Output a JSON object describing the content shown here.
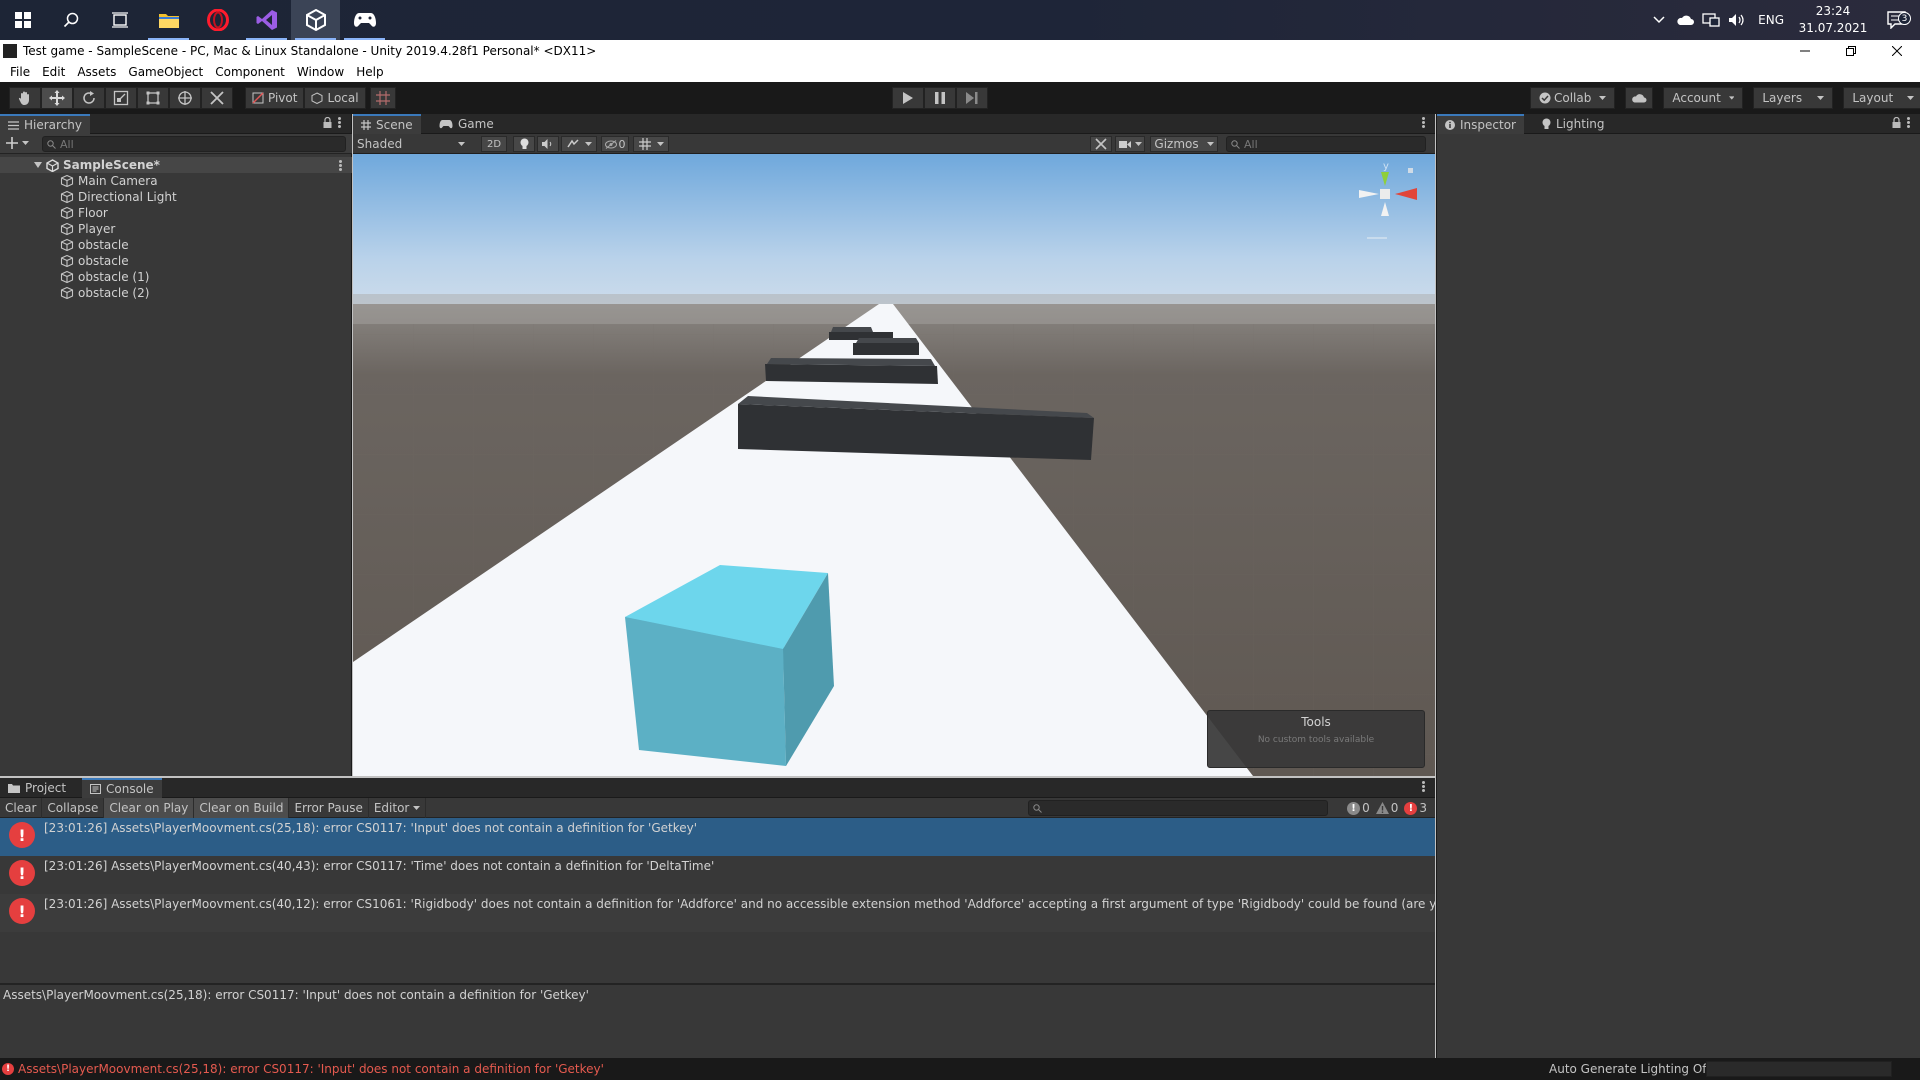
{
  "taskbar": {
    "apps": [
      "start-button",
      "search-button",
      "task-view-button",
      "file-explorer-app",
      "opera-browser-app",
      "visual-studio-app",
      "unity-app",
      "game-controller-app"
    ],
    "tray": {
      "language": "ENG",
      "time": "23:24",
      "date": "31.07.2021",
      "notifications": "3"
    }
  },
  "window": {
    "title": "Test game - SampleScene - PC, Mac & Linux Standalone - Unity 2019.4.28f1 Personal* <DX11>"
  },
  "menu": [
    "File",
    "Edit",
    "Assets",
    "GameObject",
    "Component",
    "Window",
    "Help"
  ],
  "toolbar": {
    "pivot": "Pivot",
    "local": "Local",
    "collab": "Collab",
    "account": "Account",
    "layers": "Layers",
    "layout": "Layout"
  },
  "hierarchy": {
    "tab": "Hierarchy",
    "search_placeholder": "All",
    "scene": "SampleScene*",
    "items": [
      "Main Camera",
      "Directional Light",
      "Floor",
      "Player",
      "obstacle",
      "obstacle",
      "obstacle (1)",
      "obstacle (2)"
    ]
  },
  "scene_view": {
    "tabs": [
      "Scene",
      "Game"
    ],
    "shading_mode": "Shaded",
    "mode_2d": "2D",
    "hidden_count": "0",
    "gizmos": "Gizmos",
    "search_placeholder": "All",
    "gizmo_axis": "y",
    "tools_title": "Tools",
    "tools_empty": "No custom tools available",
    "colors": {
      "sky_top": "#6fa8dc",
      "floor": "#6b6560",
      "road": "#f5f7fa",
      "cube": "#63c6dc",
      "obstacle": "#2f3134"
    }
  },
  "inspector": {
    "tabs": [
      "Inspector",
      "Lighting"
    ]
  },
  "console": {
    "tabs": [
      "Project",
      "Console"
    ],
    "buttons": [
      "Clear",
      "Collapse",
      "Clear on Play",
      "Clear on Build",
      "Error Pause",
      "Editor"
    ],
    "counts": {
      "info": "0",
      "warnings": "0",
      "errors": "3"
    },
    "logs": [
      "[23:01:26] Assets\\PlayerMoovment.cs(25,18): error CS0117: 'Input' does not contain a definition for 'Getkey'",
      "[23:01:26] Assets\\PlayerMoovment.cs(40,43): error CS0117: 'Time' does not contain a definition for 'DeltaTime'",
      "[23:01:26] Assets\\PlayerMoovment.cs(40,12): error CS1061: 'Rigidbody' does not contain a definition for 'Addforce' and no accessible extension method 'Addforce' accepting a first argument of type 'Rigidbody' could be found (are you missing a using d"
    ],
    "detail": "Assets\\PlayerMoovment.cs(25,18): error CS0117: 'Input' does not contain a definition for 'Getkey'"
  },
  "status": {
    "message": "Assets\\PlayerMoovment.cs(25,18): error CS0117: 'Input' does not contain a definition for 'Getkey'",
    "lighting": "Auto Generate Lighting Off"
  }
}
